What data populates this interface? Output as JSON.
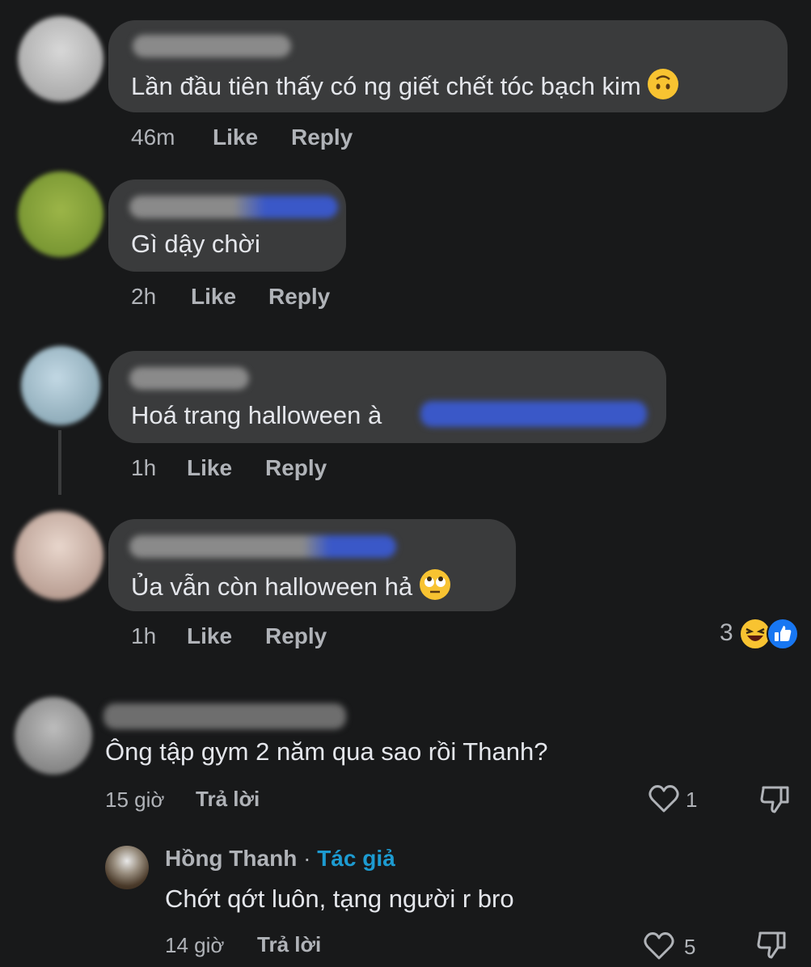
{
  "comments": [
    {
      "text": "Lần đầu tiên thấy có ng giết chết tóc bạch kim",
      "emoji": "upside-down-face",
      "time": "46m",
      "like": "Like",
      "reply": "Reply"
    },
    {
      "text": "Gì dậy chời",
      "time": "2h",
      "like": "Like",
      "reply": "Reply"
    },
    {
      "text": "Hoá trang halloween à",
      "time": "1h",
      "like": "Like",
      "reply": "Reply"
    },
    {
      "text": "Ủa vẫn còn halloween hả",
      "emoji": "rolling-eyes-face",
      "time": "1h",
      "like": "Like",
      "reply": "Reply",
      "reaction_count": "3"
    }
  ],
  "threads": [
    {
      "text": "Ông tập gym 2 năm qua sao rồi Thanh?",
      "time": "15 giờ",
      "reply": "Trả lời",
      "likes": "1"
    },
    {
      "author": "Hồng Thanh",
      "separator": "·",
      "author_badge": "Tác giả",
      "text": "Chớt qớt luôn, tạng người r bro",
      "time": "14 giờ",
      "reply": "Trả lời",
      "likes": "5"
    }
  ],
  "colors": {
    "background": "#18191a",
    "bubble": "#3a3b3c",
    "text": "#e4e6eb",
    "muted": "#b0b3b8",
    "author_badge": "#1d9bd1",
    "like_blue": "#1877f2"
  }
}
